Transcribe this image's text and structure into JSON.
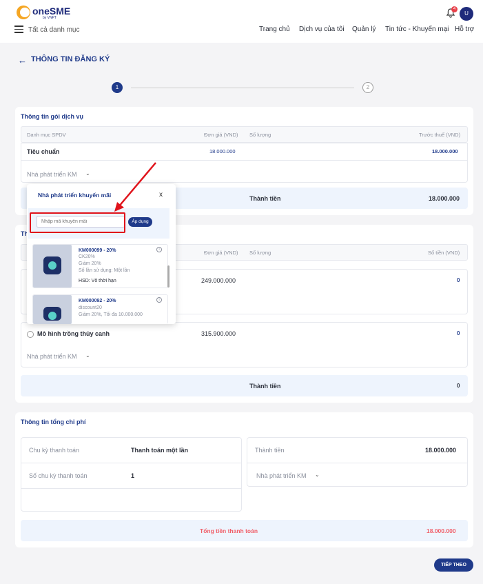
{
  "header": {
    "logo_text": "oneSME",
    "logo_sub": "by VNPT",
    "category_label": "Tất cả danh mục",
    "nav": [
      "Trang chủ",
      "Dịch vụ của tôi",
      "Quản lý",
      "Tin tức - Khuyến mại",
      "Hỗ trợ"
    ],
    "notification_count": "4",
    "avatar_letter": "U"
  },
  "page": {
    "title": "THÔNG TIN ĐĂNG KÝ",
    "steps": [
      "1",
      "2"
    ]
  },
  "service_section": {
    "title": "Thông tin gói dịch vụ",
    "headers": {
      "category": "Danh mục SPDV",
      "unit_price": "Đơn giá (VND)",
      "quantity": "Số lượng",
      "pre_tax": "Trước thuế (VND)"
    },
    "row": {
      "name": "Tiêu chuẩn",
      "unit_price": "18.000.000",
      "pre_tax": "18.000.000"
    },
    "promo_label": "Nhà phát triển KM",
    "total_label": "Thành tiền",
    "total_value": "18.000.000"
  },
  "addon_section": {
    "title": "Th",
    "headers": {
      "unit_price": "Đơn giá (VND)",
      "quantity": "Số lượng",
      "amount": "Số tiền (VND)"
    },
    "rows": [
      {
        "name": "",
        "unit_price": "249.000.000",
        "amount": "0"
      },
      {
        "name": "Mô hình trồng thủy canh",
        "unit_price": "315.900.000",
        "amount": "0"
      }
    ],
    "promo_label": "Nhà phát triển KM",
    "total_label": "Thành tiền",
    "total_value": "0"
  },
  "cost_section": {
    "title": "Thông tin tổng chi phí",
    "cycle_label": "Chu kỳ thanh toán",
    "cycle_value": "Thanh toán một lần",
    "count_label": "Số chu kỳ thanh toán",
    "count_value": "1",
    "subtotal_label": "Thành tiền",
    "subtotal_value": "18.000.000",
    "promo_label": "Nhà phát triển KM",
    "grand_label": "Tổng tiền thanh toán",
    "grand_value": "18.000.000"
  },
  "popup": {
    "title": "Nhà phát triển khuyến mãi",
    "close": "x",
    "input_placeholder": "Nhập mã khuyến mãi",
    "apply_label": "Áp dụng",
    "coupons": [
      {
        "code": "KM000099 - 20%",
        "name": "CK20%",
        "discount": "Giảm 20%",
        "usage": "Số lần sử dụng: Một lần",
        "expiry": "HSD: Vô thời hạn"
      },
      {
        "code": "KM000092 - 20%",
        "name": "discount20",
        "discount": "Giảm 20%, Tối đa 10.000.000"
      }
    ]
  },
  "next_button": "TIẾP THEO",
  "colors": {
    "primary": "#1f3a8a",
    "accent_red": "#e0131b",
    "total_red": "#f0606a",
    "bar_bg": "#eef4fd"
  }
}
